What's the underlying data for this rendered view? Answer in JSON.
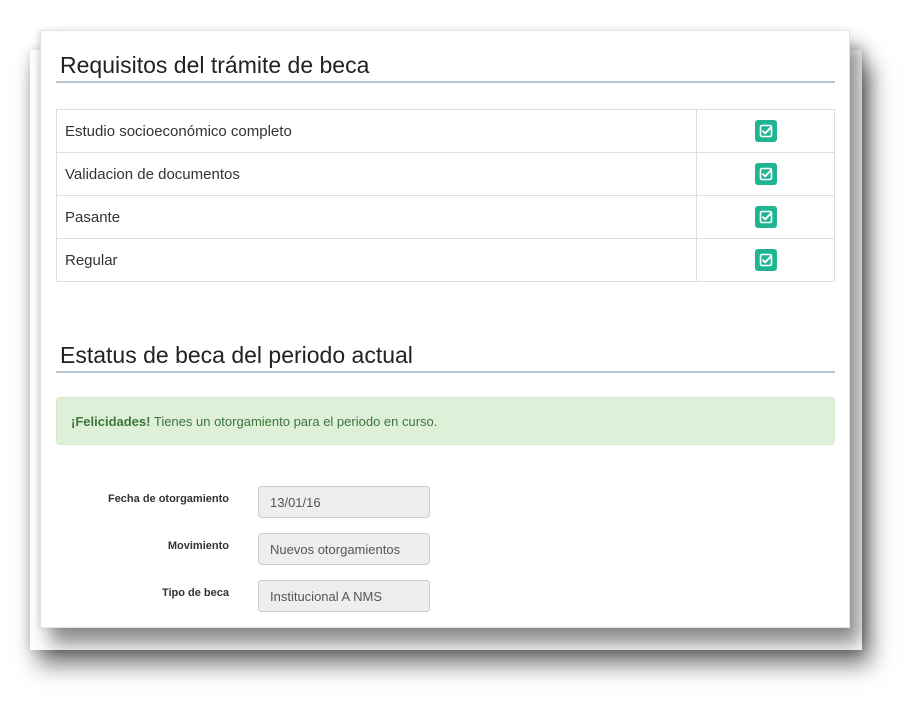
{
  "requirements": {
    "title": "Requisitos del trámite de beca",
    "items": [
      {
        "label": "Estudio socioeconómico completo",
        "checked": true
      },
      {
        "label": "Validacion de documentos",
        "checked": true
      },
      {
        "label": "Pasante",
        "checked": true
      },
      {
        "label": "Regular",
        "checked": true
      }
    ],
    "check_icon": "check-square-icon",
    "check_color": "#1fb592"
  },
  "status": {
    "title": "Estatus de beca del periodo actual",
    "alert": {
      "strong": "¡Felicidades!",
      "message": "Tienes un otorgamiento para el periodo en curso.",
      "background": "#dff0d8",
      "text_color": "#3c763d"
    },
    "fields": [
      {
        "label": "Fecha de otorgamiento",
        "value": "13/01/16"
      },
      {
        "label": "Movimiento",
        "value": "Nuevos otorgamientos"
      },
      {
        "label": "Tipo de beca",
        "value": "Institucional A NMS"
      }
    ]
  }
}
